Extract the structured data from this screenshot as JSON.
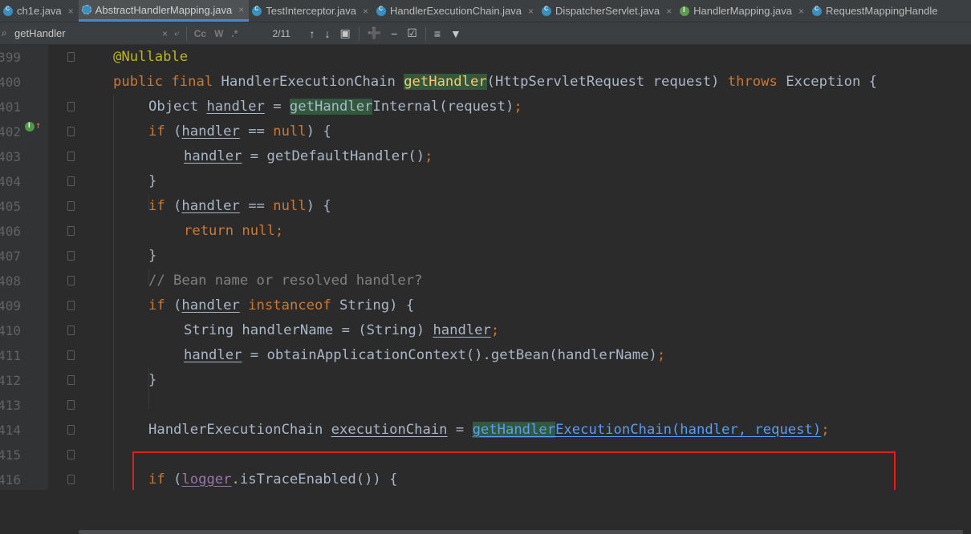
{
  "tabs": [
    {
      "label": "ch1e.java",
      "icon": "class-icon",
      "kind": "c",
      "active": false
    },
    {
      "label": "AbstractHandlerMapping.java",
      "icon": "abstract-class-icon",
      "kind": "abs",
      "active": true
    },
    {
      "label": "TestInterceptor.java",
      "icon": "class-icon",
      "kind": "c",
      "active": false
    },
    {
      "label": "HandlerExecutionChain.java",
      "icon": "class-icon",
      "kind": "c",
      "active": false
    },
    {
      "label": "DispatcherServlet.java",
      "icon": "class-icon",
      "kind": "c",
      "active": false
    },
    {
      "label": "HandlerMapping.java",
      "icon": "interface-icon",
      "kind": "i",
      "active": false
    },
    {
      "label": "RequestMappingHandle",
      "icon": "class-icon",
      "kind": "c",
      "active": false
    }
  ],
  "tab_close_glyph": "×",
  "search": {
    "query": "getHandler",
    "match_count": "2/11",
    "clear_glyph": "×",
    "history_glyph": "⤶",
    "case_label": "Cc",
    "word_label": "W",
    "regex_label": ".*"
  },
  "lines": [
    {
      "num": "399"
    },
    {
      "num": "400"
    },
    {
      "num": "401"
    },
    {
      "num": "402"
    },
    {
      "num": "403"
    },
    {
      "num": "404"
    },
    {
      "num": "405"
    },
    {
      "num": "406"
    },
    {
      "num": "407"
    },
    {
      "num": "408"
    },
    {
      "num": "409"
    },
    {
      "num": "410"
    },
    {
      "num": "411"
    },
    {
      "num": "412"
    },
    {
      "num": "413"
    },
    {
      "num": "414"
    },
    {
      "num": "415"
    },
    {
      "num": "416"
    }
  ],
  "code": {
    "l399": {
      "ann": "@Nullable"
    },
    "l400": {
      "kw1": "public final",
      "t1": " HandlerExecutionChain ",
      "m": "getHandler",
      "t2": "(HttpServletRequest request) ",
      "kw2": "throws",
      "t3": " Exception {"
    },
    "l401": {
      "t1": "Object ",
      "v": "handler",
      "t2": " = ",
      "m": "getHandler",
      "t3": "Internal(request)",
      "semi": ";"
    },
    "l402": {
      "kw": "if",
      "t1": " (",
      "v": "handler",
      "t2": " == ",
      "kw2": "null",
      "t3": ") {"
    },
    "l403": {
      "v": "handler",
      "t1": " = getDefaultHandler()",
      "semi": ";"
    },
    "l404": {
      "t": "}"
    },
    "l405": {
      "kw": "if",
      "t1": " (",
      "v": "handler",
      "t2": " == ",
      "kw2": "null",
      "t3": ") {"
    },
    "l406": {
      "kw": "return null",
      "semi": ";"
    },
    "l407": {
      "t": "}"
    },
    "l408": {
      "cmt": "// Bean name or resolved handler?"
    },
    "l409": {
      "kw": "if",
      "t1": " (",
      "v": "handler",
      "t2": " ",
      "kw2": "instanceof",
      "t3": " String) {"
    },
    "l410": {
      "t1": "String handlerName = (String) ",
      "v": "handler",
      "semi": ";"
    },
    "l411": {
      "v": "handler",
      "t1": " = obtainApplicationContext().getBean(handlerName)",
      "semi": ";"
    },
    "l412": {
      "t": "}"
    },
    "l414": {
      "t1": "HandlerExecutionChain ",
      "v": "executionChain",
      "t2": " = ",
      "m": "getHandler",
      "link": "ExecutionChain(handler, request)",
      "semi": ";"
    },
    "l416": {
      "kw": "if",
      "t1": " (",
      "logger": "logger",
      "t2": ".isTraceEnabled()) {"
    }
  },
  "colors": {
    "background": "#2b2b2b",
    "keyword": "#cc7832",
    "annotation": "#bbb529",
    "method_declaration": "#ffc66d",
    "search_highlight": "#32593d",
    "link": "#589df6",
    "red_box": "#e02020"
  }
}
